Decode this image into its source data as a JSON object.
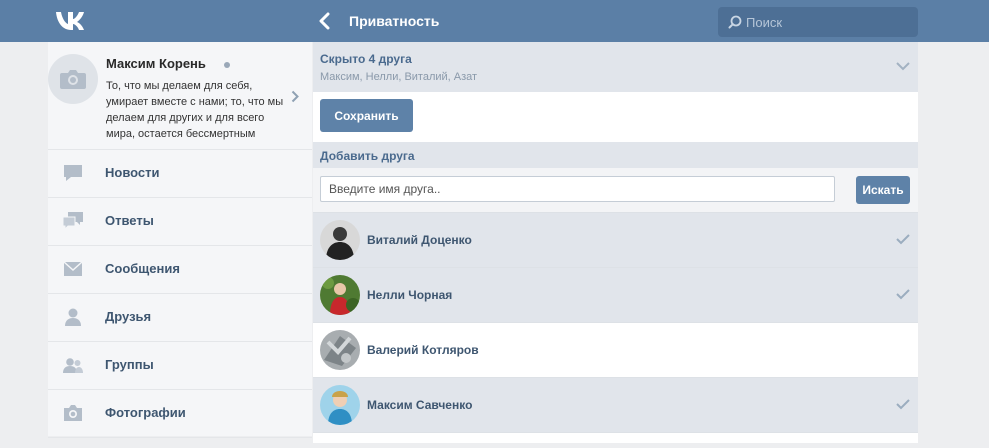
{
  "header": {
    "title": "Приватность",
    "search_placeholder": "Поиск"
  },
  "profile": {
    "name": "Максим Корень",
    "status": "То, что мы делаем для себя, умирает вместе с нами; то, что мы делаем для других и для всего мира, остается бессмертным"
  },
  "menu": [
    {
      "label": "Новости",
      "icon": "news-icon"
    },
    {
      "label": "Ответы",
      "icon": "replies-icon"
    },
    {
      "label": "Сообщения",
      "icon": "messages-icon"
    },
    {
      "label": "Друзья",
      "icon": "friends-icon"
    },
    {
      "label": "Группы",
      "icon": "groups-icon"
    },
    {
      "label": "Фотографии",
      "icon": "photos-icon"
    }
  ],
  "hidden": {
    "title": "Скрыто 4 друга",
    "names": "Максим, Нелли, Виталий, Азат"
  },
  "save_label": "Сохранить",
  "add_friend": {
    "title": "Добавить друга",
    "placeholder": "Введите имя друга..",
    "button_label": "Искать"
  },
  "friends": [
    {
      "name": "Виталий Доценко",
      "selected": true
    },
    {
      "name": "Нелли Чорная",
      "selected": true
    },
    {
      "name": "Валерий Котляров",
      "selected": false
    },
    {
      "name": "Максим Савченко",
      "selected": true
    }
  ],
  "colors": {
    "header": "#5b7fa6",
    "accent": "#5e82a8",
    "selected_row": "#e1e5eb"
  }
}
